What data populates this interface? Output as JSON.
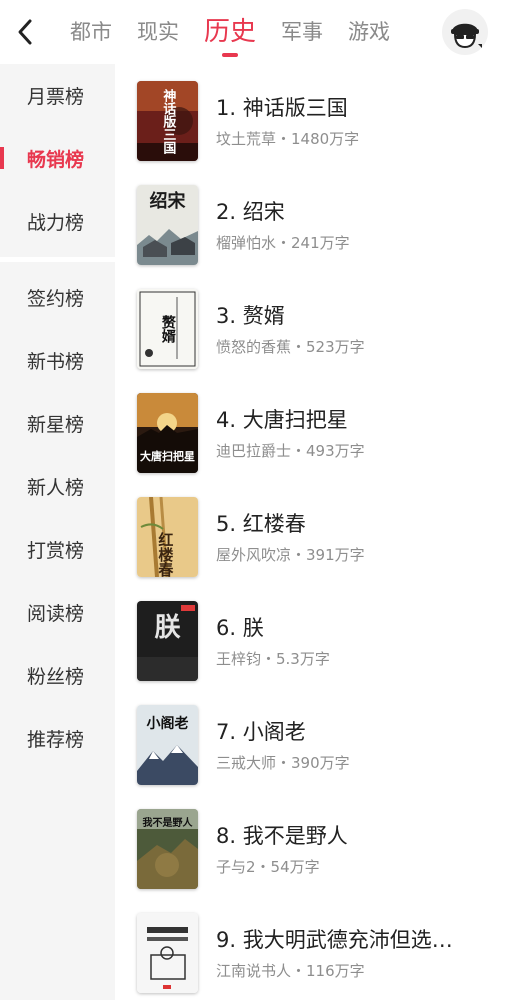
{
  "tabs": [
    {
      "label": "都市",
      "active": false
    },
    {
      "label": "现实",
      "active": false
    },
    {
      "label": "历史",
      "active": true
    },
    {
      "label": "军事",
      "active": false
    },
    {
      "label": "游戏",
      "active": false
    }
  ],
  "sidebar": {
    "group1": [
      {
        "label": "月票榜",
        "active": false
      },
      {
        "label": "畅销榜",
        "active": true
      },
      {
        "label": "战力榜",
        "active": false
      }
    ],
    "group2": [
      {
        "label": "签约榜"
      },
      {
        "label": "新书榜"
      },
      {
        "label": "新星榜"
      },
      {
        "label": "新人榜"
      },
      {
        "label": "打赏榜"
      },
      {
        "label": "阅读榜"
      },
      {
        "label": "粉丝榜"
      },
      {
        "label": "推荐榜"
      }
    ]
  },
  "books": [
    {
      "title": "1. 神话版三国",
      "meta": "坟土荒草・1480万字",
      "cover_text": "神话版三国",
      "cover_bg": "#6b1f1a"
    },
    {
      "title": "2. 绍宋",
      "meta": "榴弹怕水・241万字",
      "cover_text": "绍宋",
      "cover_bg": "#e8e8e2"
    },
    {
      "title": "3. 赘婿",
      "meta": "愤怒的香蕉・523万字",
      "cover_text": "赘婿",
      "cover_bg": "#f7f7f3"
    },
    {
      "title": "4. 大唐扫把星",
      "meta": "迪巴拉爵士・493万字",
      "cover_text": "大唐扫把星",
      "cover_bg": "#2b1a10"
    },
    {
      "title": "5. 红楼春",
      "meta": "屋外风吹凉・391万字",
      "cover_text": "红楼春",
      "cover_bg": "#e9c989"
    },
    {
      "title": "6. 朕",
      "meta": "王梓钧・5.3万字",
      "cover_text": "朕",
      "cover_bg": "#1e1e1e"
    },
    {
      "title": "7. 小阁老",
      "meta": "三戒大师・390万字",
      "cover_text": "小阁老",
      "cover_bg": "#dfe6ea"
    },
    {
      "title": "8. 我不是野人",
      "meta": "子与2・54万字",
      "cover_text": "我不是野人",
      "cover_bg": "#4d5a3a"
    },
    {
      "title": "9. 我大明武德充沛但选…",
      "meta": "江南说书人・116万字",
      "cover_text": "",
      "cover_bg": "#f6f6f6"
    }
  ]
}
